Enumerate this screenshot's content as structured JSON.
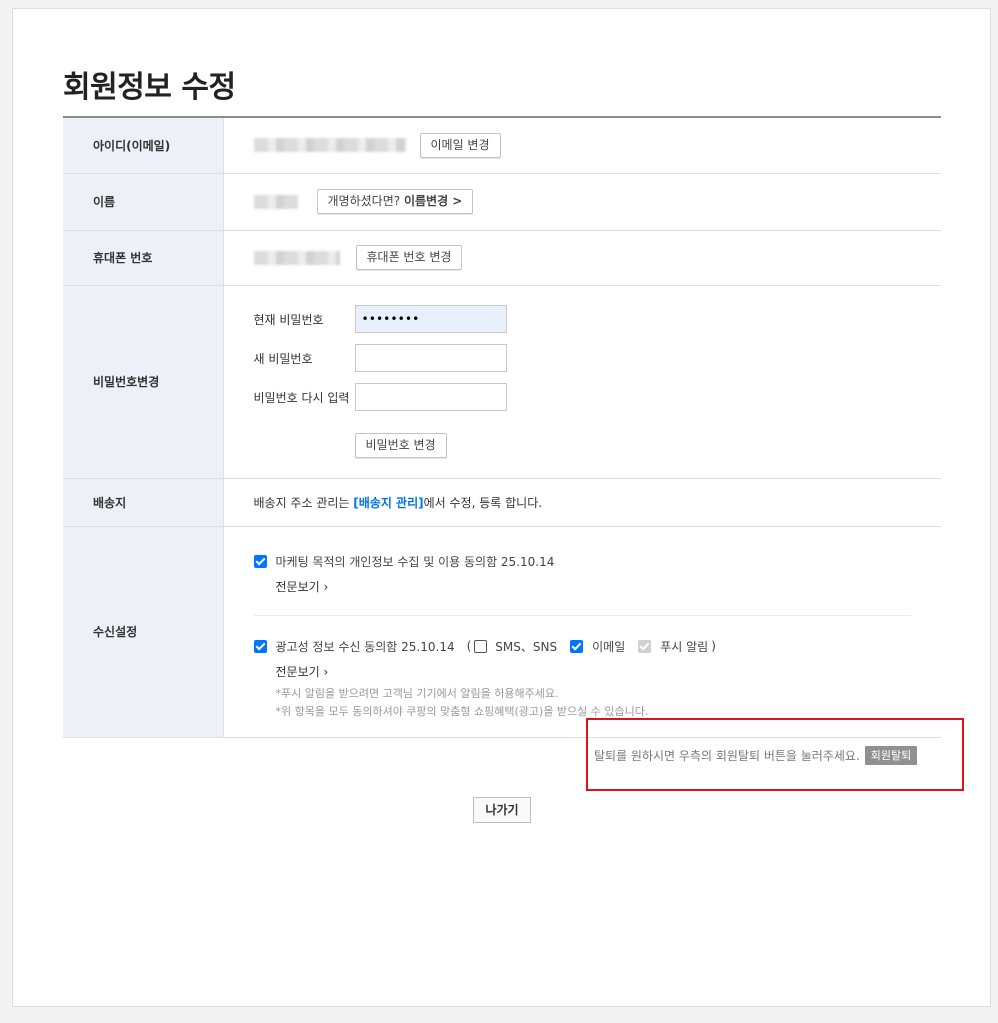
{
  "page": {
    "title": "회원정보 수정"
  },
  "rows": {
    "email": {
      "label": "아이디(이메일)",
      "change_button": "이메일 변경"
    },
    "name": {
      "label": "이름",
      "change_prefix": "개명하셨다면?",
      "change_button": "이름변경 >"
    },
    "phone": {
      "label": "휴대폰 번호",
      "change_button": "휴대폰 번호 변경"
    },
    "password": {
      "label": "비밀번호변경",
      "current_label": "현재 비밀번호",
      "current_value": "••••••••",
      "new_label": "새 비밀번호",
      "confirm_label": "비밀번호 다시 입력",
      "change_button": "비밀번호 변경"
    },
    "shipping": {
      "label": "배송지",
      "text_before": "배송지 주소 관리는 ",
      "link": "[배송지 관리]",
      "text_after": "에서 수정, 등록 합니다."
    },
    "receive": {
      "label": "수신설정",
      "marketing": {
        "text": "마케팅 목적의 개인정보 수집 및 이용 동의함 25.10.14",
        "checked": true,
        "view_link": "전문보기 ›"
      },
      "ad": {
        "text": "광고성 정보 수신 동의함 25.10.14",
        "checked": true,
        "paren_open": "(",
        "sms_label": "SMS、SNS",
        "sms_checked": false,
        "email_label": "이메일",
        "email_checked": true,
        "push_label": "푸시 알림",
        "push_checked": true,
        "push_disabled": true,
        "paren_close": ")",
        "view_link": "전문보기 ›",
        "note1": "*푸시 알림을 받으려면 고객님 기기에서 알림을 허용해주세요.",
        "note2": "*위 항목을 모두 동의하셔야 쿠팡의 맞춤형 쇼핑혜택(광고)을 받으실 수 있습니다."
      }
    }
  },
  "withdraw": {
    "text": "탈퇴를 원하시면 우측의 회원탈퇴 버튼을 눌러주세요.",
    "button": "회원탈퇴"
  },
  "exit_button": "나가기",
  "colors": {
    "header_bg": "#edf0f6",
    "link_blue": "#0073e9",
    "checkbox_blue": "#0075ff",
    "highlight_red": "#e0111b"
  }
}
